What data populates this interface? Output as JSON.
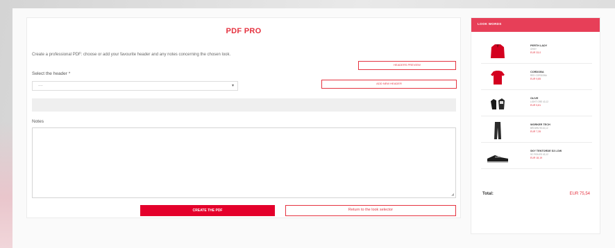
{
  "colors": {
    "accent": "#e4002b",
    "sidebar_header": "#e73f58",
    "text": "#555555"
  },
  "form": {
    "title": "PDF PRO",
    "intro": "Create a professional PDF: choose or add your favourite header and any notes concerning the chosen look.",
    "header_preview_label": "HEADERS PREVIEW",
    "select_label": "Select the header *",
    "select_value": "----",
    "add_header_label": "ADD NEW HEADER",
    "notes_label": "Notes",
    "create_pdf_label": "CREATE THE PDF",
    "return_label": "Return to the look selector"
  },
  "sidebar": {
    "header": "LOOK WORDS",
    "items": [
      {
        "name": "PERTH LADY",
        "sub": "GREY",
        "price": "EUR 33,0",
        "icon": "jacket-icon"
      },
      {
        "name": "CORDOBA",
        "sub": "RED CORDOBA",
        "price": "EUR 9,85",
        "icon": "tshirt-icon"
      },
      {
        "name": "OLIVE",
        "sub": "LIGHT GRE 43,12",
        "price": "EUR 5,81",
        "icon": "gloves-icon"
      },
      {
        "name": "WORKER TECH",
        "sub": "BROWN 95 43,12",
        "price": "EUR 7,35",
        "icon": "pants-icon"
      },
      {
        "name": "SKY TENTORDE S3 LOW",
        "sub": "SC ROILES 43,12",
        "price": "EUR 18,19",
        "icon": "shoe-icon"
      }
    ],
    "total_label": "Total:",
    "total_value": "EUR 75,54"
  }
}
